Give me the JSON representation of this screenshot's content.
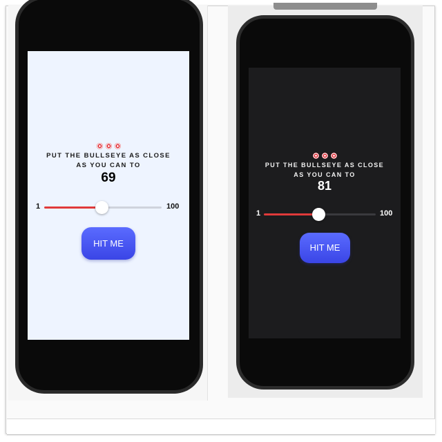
{
  "colors": {
    "light_bg": "#eef4ff",
    "dark_bg": "#1c1c1e",
    "slider_fill": "#e03a3a",
    "button": "#4a55f0"
  },
  "left_phone": {
    "theme": "light",
    "emoji": "🎯🎯🎯",
    "instruction_line1": "PUT THE BULLSEYE AS CLOSE",
    "instruction_line2": "AS YOU CAN TO",
    "target_value": "69",
    "slider": {
      "min_label": "1",
      "max_label": "100",
      "value_fraction": 0.5
    },
    "button_label": "HIT ME"
  },
  "right_phone": {
    "theme": "dark",
    "emoji": "🎯🎯🎯",
    "instruction_line1": "PUT THE BULLSEYE AS CLOSE",
    "instruction_line2": "AS YOU CAN TO",
    "target_value": "81",
    "slider": {
      "min_label": "1",
      "max_label": "100",
      "value_fraction": 0.5
    },
    "button_label": "HIT ME"
  }
}
